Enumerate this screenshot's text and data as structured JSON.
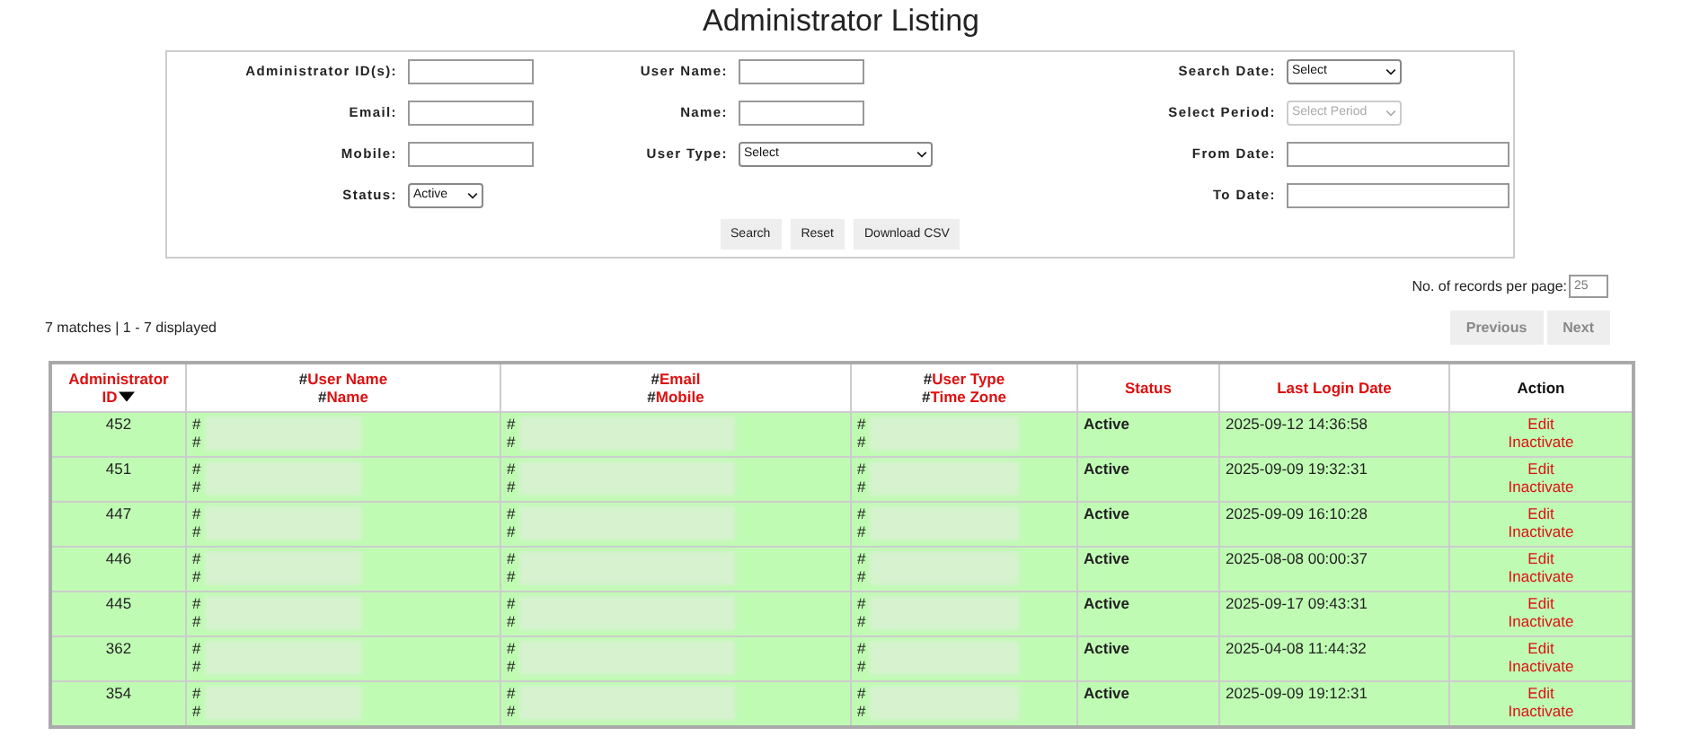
{
  "title": "Administrator Listing",
  "filter_columns": [
    [
      {
        "label": "Administrator ID(s):",
        "kind": "text"
      },
      {
        "label": "Email:",
        "kind": "text"
      },
      {
        "label": "Mobile:",
        "kind": "text"
      },
      {
        "label": "Status:",
        "kind": "select",
        "value": "Active",
        "disabled": false
      }
    ],
    [
      {
        "label": "User Name:",
        "kind": "text"
      },
      {
        "label": "Name:",
        "kind": "text"
      },
      {
        "label": "User Type:",
        "kind": "wideselect",
        "value": "Select",
        "disabled": false
      }
    ],
    [
      {
        "label": "Search Date:",
        "kind": "select",
        "value": "Select",
        "disabled": false
      },
      {
        "label": "Select Period:",
        "kind": "select",
        "value": "Select Period",
        "disabled": true
      },
      {
        "label": "From Date:",
        "kind": "date"
      },
      {
        "label": "To Date:",
        "kind": "date"
      }
    ]
  ],
  "buttons": [
    "Search",
    "Reset",
    "Download CSV"
  ],
  "records_per_page": {
    "label": "No. of records per page:",
    "value": "25"
  },
  "summary": "7 matches | 1 - 7 displayed",
  "pager": [
    "Previous",
    "Next"
  ],
  "table": {
    "columns": [
      {
        "kind": "sortable",
        "lines": [
          {
            "text": "Administrator"
          },
          {
            "text": "ID"
          }
        ],
        "sorted": true
      },
      {
        "kind": "sortable",
        "lines": [
          {
            "prefix": "#",
            "text": "User Name"
          },
          {
            "prefix": "#",
            "text": "Name"
          }
        ],
        "sorted": false
      },
      {
        "kind": "sortable",
        "lines": [
          {
            "prefix": "#",
            "text": "Email"
          },
          {
            "prefix": "#",
            "text": "Mobile"
          }
        ],
        "sorted": false
      },
      {
        "kind": "sortable",
        "lines": [
          {
            "prefix": "#",
            "text": "User Type"
          },
          {
            "prefix": "#",
            "text": "Time Zone"
          }
        ],
        "sorted": false
      },
      {
        "kind": "sortable",
        "lines": [
          {
            "text": "Status"
          }
        ],
        "sorted": false
      },
      {
        "kind": "sortable",
        "lines": [
          {
            "text": "Last Login Date"
          }
        ],
        "sorted": false
      },
      {
        "kind": "plain",
        "lines": [
          {
            "text": "Action"
          }
        ]
      }
    ],
    "rows": [
      {
        "id": "452",
        "user": [
          "#",
          "#"
        ],
        "contact": [
          "#",
          "#"
        ],
        "type": [
          "#",
          "#"
        ],
        "status": "Active",
        "last_login": "2025-09-12 14:36:58",
        "actions": [
          "Edit",
          "Inactivate"
        ]
      },
      {
        "id": "451",
        "user": [
          "#",
          "#"
        ],
        "contact": [
          "#",
          "#"
        ],
        "type": [
          "#",
          "#"
        ],
        "status": "Active",
        "last_login": "2025-09-09 19:32:31",
        "actions": [
          "Edit",
          "Inactivate"
        ]
      },
      {
        "id": "447",
        "user": [
          "#",
          "#"
        ],
        "contact": [
          "#",
          "#"
        ],
        "type": [
          "#",
          "#"
        ],
        "status": "Active",
        "last_login": "2025-09-09 16:10:28",
        "actions": [
          "Edit",
          "Inactivate"
        ]
      },
      {
        "id": "446",
        "user": [
          "#",
          "#"
        ],
        "contact": [
          "#",
          "#"
        ],
        "type": [
          "#",
          "#"
        ],
        "status": "Active",
        "last_login": "2025-08-08 00:00:37",
        "actions": [
          "Edit",
          "Inactivate"
        ]
      },
      {
        "id": "445",
        "user": [
          "#",
          "#"
        ],
        "contact": [
          "#",
          "#"
        ],
        "type": [
          "#",
          "#"
        ],
        "status": "Active",
        "last_login": "2025-09-17 09:43:31",
        "actions": [
          "Edit",
          "Inactivate"
        ]
      },
      {
        "id": "362",
        "user": [
          "#",
          "#"
        ],
        "contact": [
          "#",
          "#"
        ],
        "type": [
          "#",
          "#"
        ],
        "status": "Active",
        "last_login": "2025-04-08 11:44:32",
        "actions": [
          "Edit",
          "Inactivate"
        ]
      },
      {
        "id": "354",
        "user": [
          "#",
          "#"
        ],
        "contact": [
          "#",
          "#"
        ],
        "type": [
          "#",
          "#"
        ],
        "status": "Active",
        "last_login": "2025-09-09 19:12:31",
        "actions": [
          "Edit",
          "Inactivate"
        ]
      }
    ]
  }
}
